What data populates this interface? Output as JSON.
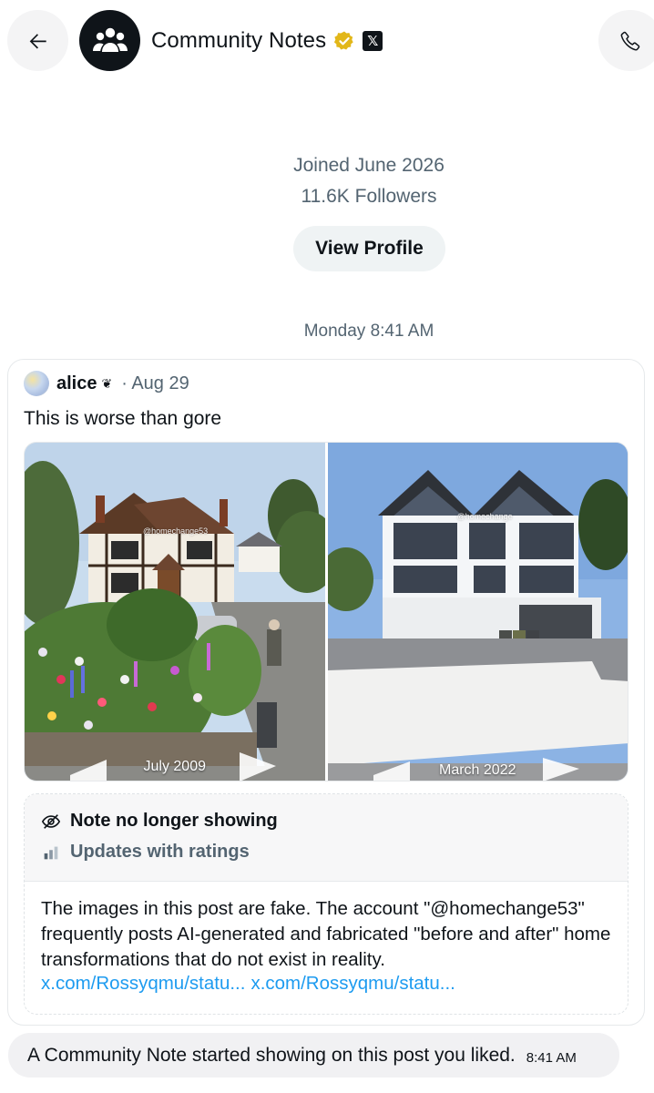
{
  "header": {
    "title": "Community Notes",
    "x_badge": "𝕏"
  },
  "profile": {
    "joined": "Joined June 2026",
    "followers": "11.6K Followers",
    "view_profile_label": "View Profile"
  },
  "date_separator": "Monday 8:41 AM",
  "post": {
    "author": "alice",
    "author_emoji": "❦",
    "date": "· Aug 29",
    "text": "This is worse than gore",
    "images": [
      {
        "caption": "July 2009",
        "watermark": "@homechange53"
      },
      {
        "caption": "March 2022",
        "watermark": "@homechange"
      }
    ],
    "note": {
      "status": "Note no longer showing",
      "updates": "Updates with ratings",
      "body": "The images in this post are fake. The account \"@homechange53\" frequently posts AI-generated and fabricated \"before and after\" home transformations that do not exist in reality.",
      "links": [
        "x.com/Rossyqmu/statu...",
        "x.com/Rossyqmu/statu..."
      ]
    }
  },
  "message": {
    "text": "A Community Note started showing on this post you liked.",
    "time": "8:41 AM"
  },
  "colors": {
    "link": "#1d9bf0",
    "secondary_text": "#536471",
    "verified_gold": "#e2b719"
  }
}
